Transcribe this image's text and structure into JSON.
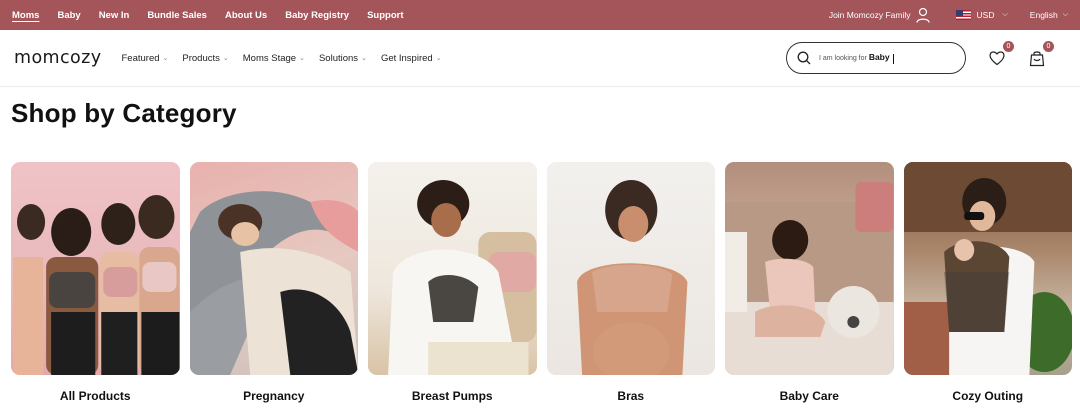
{
  "topbar": {
    "links": [
      "Moms",
      "Baby",
      "New In",
      "Bundle Sales",
      "About Us",
      "Baby Registry",
      "Support"
    ],
    "active_link": "Moms",
    "join_label": "Join Momcozy Family",
    "currency": "USD",
    "language": "English"
  },
  "nav": {
    "logo": "momcozy",
    "items": [
      "Featured",
      "Products",
      "Moms Stage",
      "Solutions",
      "Get Inspired"
    ],
    "search_prefix": "I am looking for",
    "search_term": "Baby",
    "wishlist_count": "0",
    "cart_count": "0"
  },
  "main": {
    "title": "Shop by Category",
    "categories": [
      {
        "label": "All Products"
      },
      {
        "label": "Pregnancy"
      },
      {
        "label": "Breast Pumps"
      },
      {
        "label": "Bras"
      },
      {
        "label": "Baby Care"
      },
      {
        "label": "Cozy Outing"
      }
    ]
  },
  "colors": {
    "brand": "#a3555a",
    "text": "#111111"
  },
  "icons": [
    "user-icon",
    "us-flag-icon",
    "chevron-down-icon",
    "search-icon",
    "heart-icon",
    "cart-bag-icon"
  ]
}
